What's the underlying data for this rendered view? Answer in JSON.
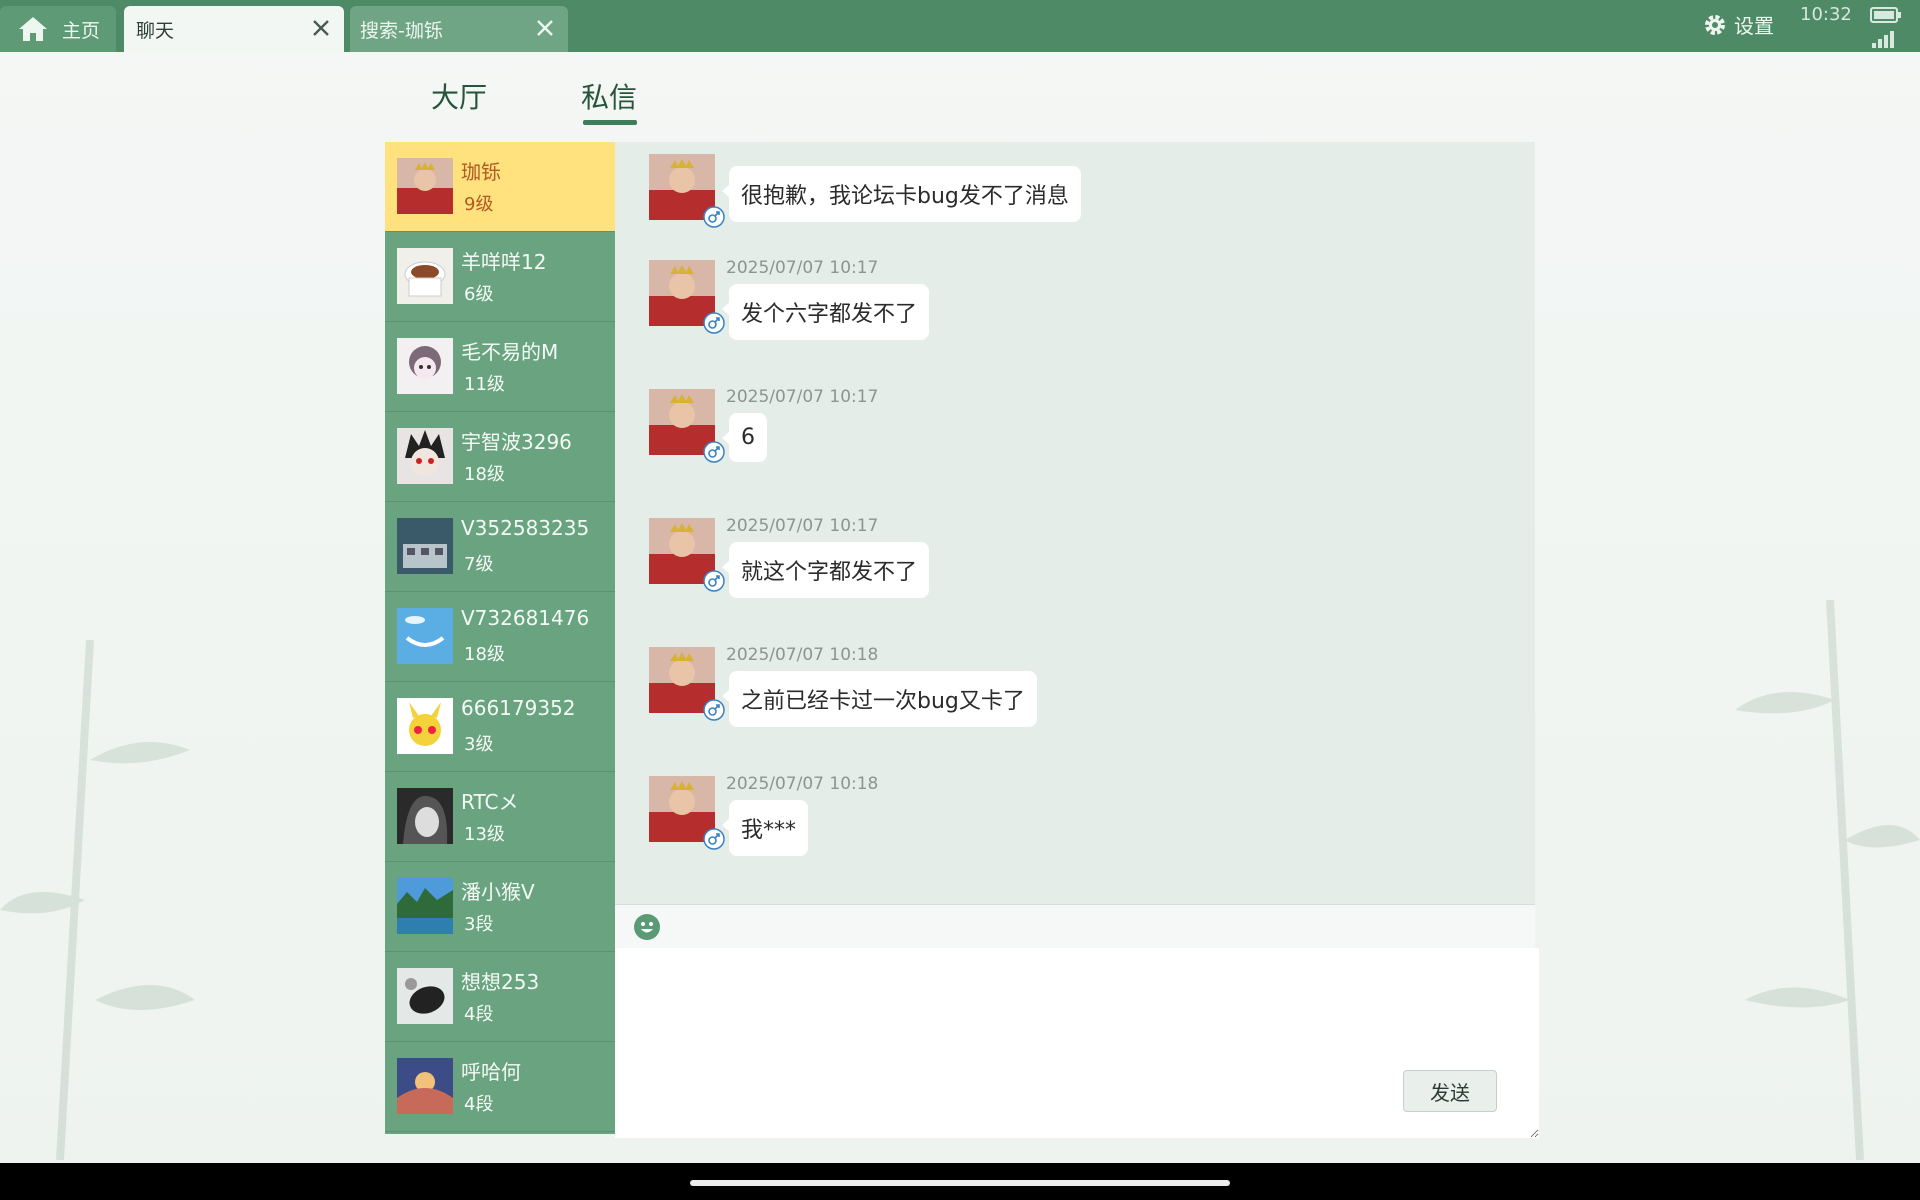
{
  "window_tabs": [
    {
      "label": "主页",
      "icon": "home-icon"
    },
    {
      "label": "聊天",
      "active": true
    },
    {
      "label": "搜索-珈铄"
    }
  ],
  "status": {
    "settings_label": "设置",
    "time": "10:32"
  },
  "main_tabs": [
    {
      "label": "大厅"
    },
    {
      "label": "私信",
      "active": true
    }
  ],
  "contacts": [
    {
      "name": "珈铄",
      "level": "9级",
      "active": true
    },
    {
      "name": "羊咩咩12",
      "level": "6级"
    },
    {
      "name": "毛不易的M",
      "level": "11级"
    },
    {
      "name": "宇智波3296",
      "level": "18级"
    },
    {
      "name": "V352583235",
      "level": "7级"
    },
    {
      "name": "V732681476",
      "level": "18级"
    },
    {
      "name": "666179352",
      "level": "3级"
    },
    {
      "name": "RTCメ",
      "level": "13级"
    },
    {
      "name": "潘小猴V",
      "level": "3段"
    },
    {
      "name": "想想253",
      "level": "4段"
    },
    {
      "name": "呼哈何",
      "level": "4段"
    }
  ],
  "messages": [
    {
      "time": "",
      "text": "很抱歉，我论坛卡bug发不了消息"
    },
    {
      "time": "2025/07/07 10:17",
      "text": "发个六字都发不了"
    },
    {
      "time": "2025/07/07 10:17",
      "text": "6"
    },
    {
      "time": "2025/07/07 10:17",
      "text": "就这个字都发不了"
    },
    {
      "time": "2025/07/07 10:18",
      "text": "之前已经卡过一次bug又卡了"
    },
    {
      "time": "2025/07/07 10:18",
      "text": "我***"
    }
  ],
  "composer": {
    "send_label": "发送",
    "input_value": ""
  },
  "colors": {
    "topbar": "#4f8a67",
    "contact_list": "#6aa380",
    "active_contact": "#ffe27d",
    "chat_bg": "#e4ede8"
  }
}
